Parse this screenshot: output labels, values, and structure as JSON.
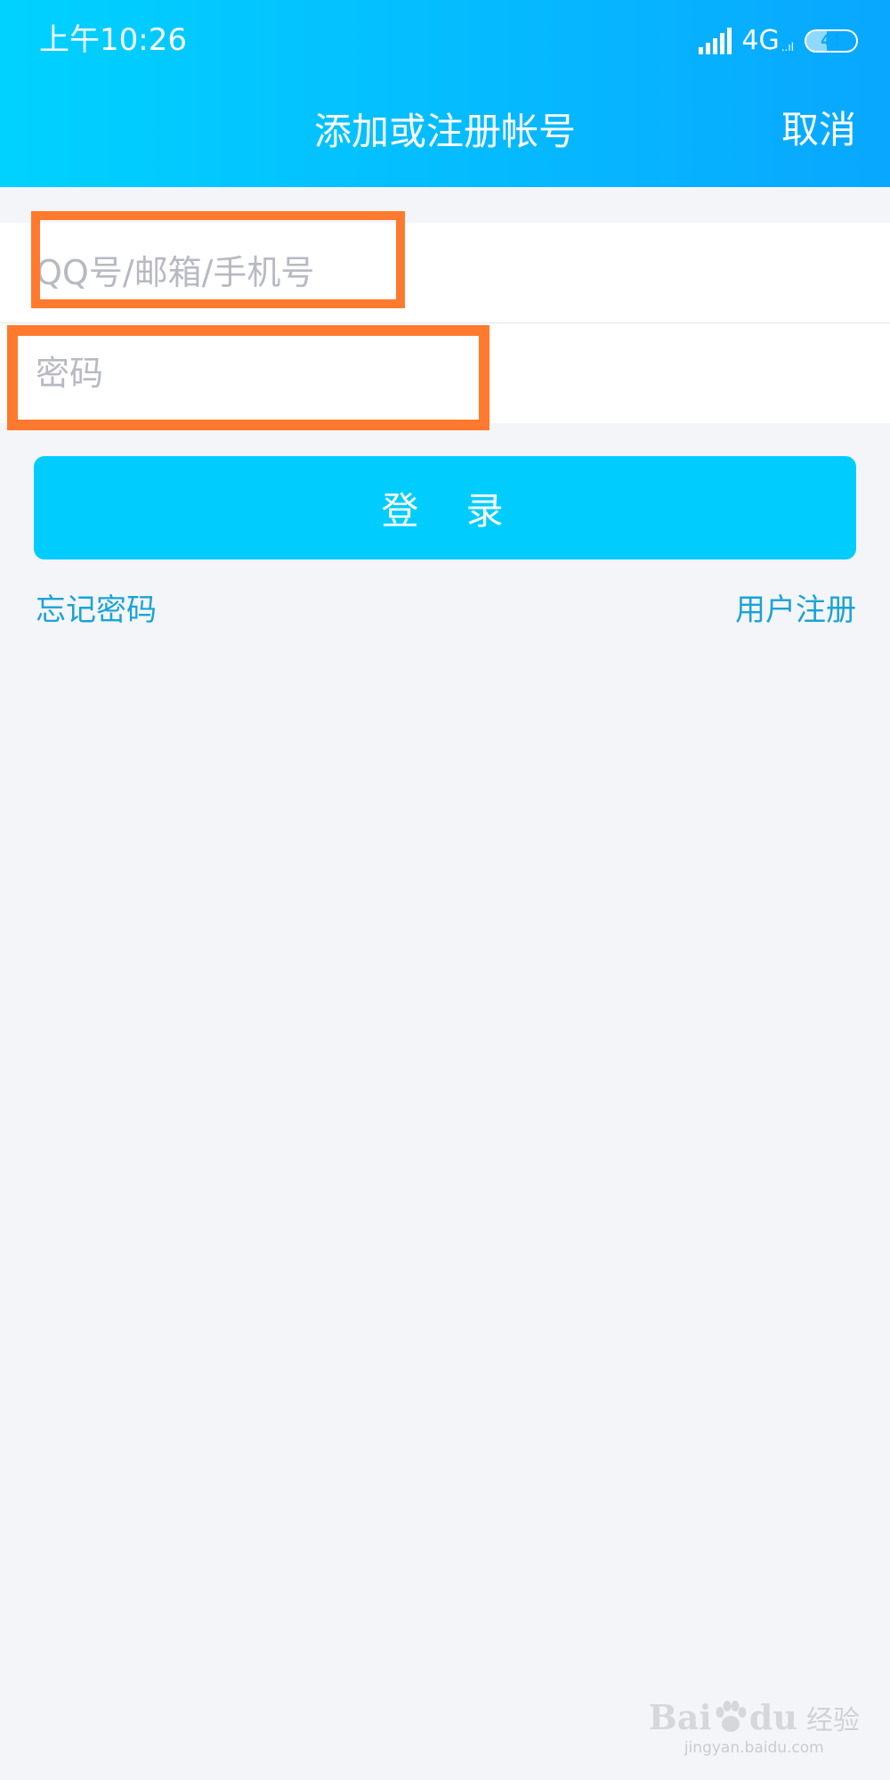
{
  "status_bar": {
    "time": "上午10:26",
    "network": "4G",
    "network_sub": "..ıl",
    "battery": "41",
    "battery_level": 0.41
  },
  "header": {
    "title": "添加或注册帐号",
    "cancel_label": "取消"
  },
  "form": {
    "account_placeholder": "QQ号/邮箱/手机号",
    "password_placeholder": "密码"
  },
  "login_label": "登 录",
  "links": {
    "forgot": "忘记密码",
    "register": "用户注册"
  },
  "watermark": {
    "brand_left": "Bai",
    "brand_right": "du",
    "brand_cn": "经验",
    "url": "jingyan.baidu.com"
  },
  "colors": {
    "header_start": "#00d2ff",
    "header_end": "#09a7ff",
    "login_button": "#00ccfe",
    "link": "#1aa3d6",
    "highlight": "#ff7a2e"
  }
}
